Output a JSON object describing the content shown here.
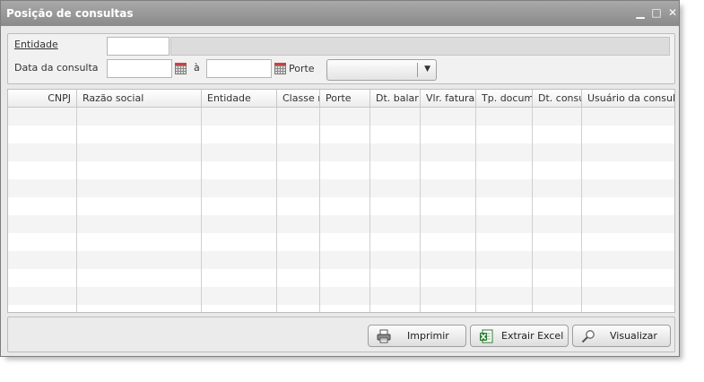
{
  "window": {
    "title": "Posição de consultas",
    "minimize_glyph": "▁",
    "maximize_glyph": "□",
    "close_glyph": "✕"
  },
  "filters": {
    "entidade_label": "Entidade",
    "data_label": "Data da consulta",
    "range_separator": "à",
    "porte_label": "Porte",
    "entidade_code_value": "",
    "entidade_name_value": "",
    "date_from_value": "",
    "date_to_value": "",
    "porte_selected": ""
  },
  "grid": {
    "columns": [
      "CNPJ",
      "Razão social",
      "Entidade",
      "Classe r",
      "Porte",
      "Dt. balar",
      "Vlr. fatura",
      "Tp. docum",
      "Dt. consu",
      "Usuário da consul"
    ],
    "rows": []
  },
  "actions": {
    "print_label": "Imprimir",
    "excel_label": "Extrair Excel",
    "view_label": "Visualizar"
  },
  "colors": {
    "titlebar": "#999999",
    "panel": "#e9e9e9",
    "row_stripe": "#f4f4f4"
  },
  "icons": {
    "print": "printer-icon",
    "excel": "excel-icon",
    "view": "magnifier-icon",
    "calendar": "calendar-icon"
  }
}
